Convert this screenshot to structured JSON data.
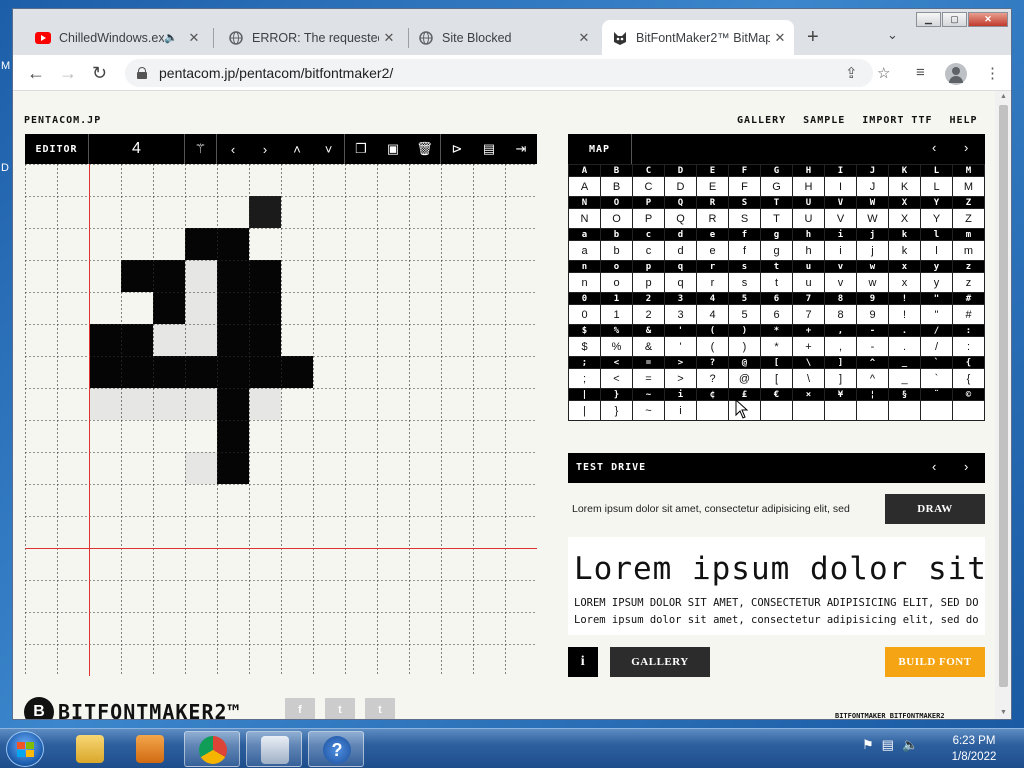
{
  "desktop": {
    "left_glyph_1": "M",
    "left_glyph_2": "D"
  },
  "browser": {
    "tabs": [
      {
        "title": "ChilledWindows.exe",
        "icon": "youtube-icon",
        "audio": true
      },
      {
        "title": "ERROR: The requested U",
        "icon": "globe-icon"
      },
      {
        "title": "Site Blocked",
        "icon": "globe-icon"
      },
      {
        "title": "BitFontMaker2™ BitMap",
        "icon": "pentacom-cat-icon",
        "active": true
      }
    ],
    "url": "pentacom.jp/pentacom/bitfontmaker2/"
  },
  "site": {
    "brand": "PENTACOM.JP",
    "nav": [
      "GALLERY",
      "SAMPLE",
      "IMPORT TTF",
      "HELP"
    ]
  },
  "editor": {
    "label": "EDITOR",
    "current_char": "4",
    "tool_icons": [
      "magic-wand-icon",
      "left-arrow-icon",
      "right-arrow-icon",
      "up-arrow-icon",
      "down-arrow-icon",
      "copy-icon",
      "paste-icon",
      "trash-icon",
      "open-icon",
      "save-icon",
      "export-icon"
    ],
    "pixels": [
      [
        5,
        2,
        3
      ],
      [
        6,
        2,
        3
      ],
      [
        7,
        1,
        1
      ],
      [
        4,
        3,
        3
      ],
      [
        5,
        3,
        0
      ],
      [
        6,
        3,
        3
      ],
      [
        7,
        3,
        3
      ],
      [
        3,
        3,
        3
      ],
      [
        4,
        4,
        3
      ],
      [
        5,
        4,
        0
      ],
      [
        6,
        4,
        3
      ],
      [
        7,
        4,
        3
      ],
      [
        2,
        5,
        3
      ],
      [
        3,
        5,
        3
      ],
      [
        4,
        5,
        0
      ],
      [
        5,
        5,
        0
      ],
      [
        6,
        5,
        3
      ],
      [
        7,
        5,
        3
      ],
      [
        2,
        6,
        3
      ],
      [
        3,
        6,
        3
      ],
      [
        4,
        6,
        3
      ],
      [
        5,
        6,
        3
      ],
      [
        6,
        6,
        3
      ],
      [
        7,
        6,
        3
      ],
      [
        8,
        6,
        3
      ],
      [
        2,
        7,
        0
      ],
      [
        3,
        7,
        0
      ],
      [
        4,
        7,
        0
      ],
      [
        5,
        7,
        0
      ],
      [
        6,
        7,
        3
      ],
      [
        7,
        7,
        0
      ],
      [
        6,
        8,
        3
      ],
      [
        6,
        9,
        3
      ],
      [
        5,
        9,
        0
      ]
    ]
  },
  "map": {
    "label": "MAP",
    "rows": [
      [
        "A",
        "B",
        "C",
        "D",
        "E",
        "F",
        "G",
        "H",
        "I",
        "J",
        "K",
        "L",
        "M"
      ],
      [
        "N",
        "O",
        "P",
        "Q",
        "R",
        "S",
        "T",
        "U",
        "V",
        "W",
        "X",
        "Y",
        "Z"
      ],
      [
        "a",
        "b",
        "c",
        "d",
        "e",
        "f",
        "g",
        "h",
        "i",
        "j",
        "k",
        "l",
        "m"
      ],
      [
        "n",
        "o",
        "p",
        "q",
        "r",
        "s",
        "t",
        "u",
        "v",
        "w",
        "x",
        "y",
        "z"
      ],
      [
        "0",
        "1",
        "2",
        "3",
        "4",
        "5",
        "6",
        "7",
        "8",
        "9",
        "!",
        "\"",
        "#"
      ],
      [
        "$",
        "%",
        "&",
        "'",
        "(",
        ")",
        "*",
        "+",
        ",",
        "-",
        ".",
        "/",
        ":"
      ],
      [
        ";",
        "<",
        "=",
        ">",
        "?",
        "@",
        "[",
        "\\",
        "]",
        "^",
        "_",
        "`",
        "{"
      ],
      [
        "|",
        "}",
        "~",
        "i",
        "¢",
        "£",
        "€",
        "×",
        "¥",
        "¦",
        "§",
        "¨",
        "©"
      ]
    ],
    "last_row_filled": [
      "|",
      "}",
      "~",
      "i",
      "",
      "",
      "",
      "",
      "",
      "",
      "",
      "",
      ""
    ]
  },
  "test_drive": {
    "label": "TEST DRIVE",
    "sample_text": "Lorem ipsum dolor sit amet, consectetur adipisicing elit, sed",
    "draw_label": "DRAW",
    "preview_big": "Lorem ipsum dolor sit amet",
    "preview_caps": "LOREM IPSUM DOLOR SIT AMET, CONSECTETUR ADIPISICING ELIT, SED DO",
    "preview_mixed": "Lorem ipsum dolor sit amet, consectetur adipisicing elit, sed do eiusmod tem"
  },
  "actions": {
    "info_label": "i",
    "gallery_label": "GALLERY",
    "build_label": "BUILD FONT"
  },
  "footer": {
    "logo_word": "BITFONTMAKER2™",
    "logo_letter": "B",
    "right_text": "BITFONTMAKER BITFONTMAKER2",
    "social": [
      "f",
      "t",
      "t"
    ]
  },
  "taskbar": {
    "time": "6:23 PM",
    "date": "1/8/2022"
  },
  "colors": {
    "build_orange": "#f5a513",
    "dark_button": "#2c2c2c",
    "guide_red": "#d33"
  }
}
